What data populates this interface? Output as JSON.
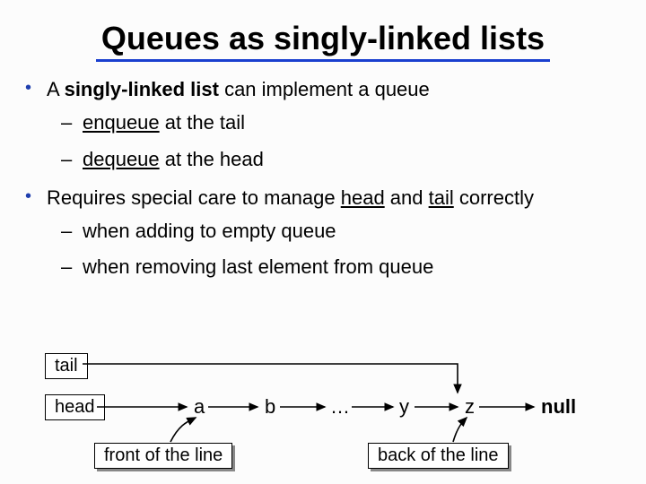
{
  "title": "Queues as singly-linked lists",
  "bullets": {
    "b1_pre": "A ",
    "b1_bold": "singly-linked list",
    "b1_post": " can implement a queue",
    "b1a_pre": "",
    "b1a_ul": "enqueue",
    "b1a_post": " at the tail",
    "b1b_pre": "",
    "b1b_ul": "dequeue",
    "b1b_post": " at the head",
    "b2_pre": "Requires special care to manage ",
    "b2_ul1": "head",
    "b2_mid": " and ",
    "b2_ul2": "tail",
    "b2_post": " correctly",
    "b2a": "when adding to empty queue",
    "b2b": "when removing last element from queue"
  },
  "diagram": {
    "tail": "tail",
    "head": "head",
    "a": "a",
    "b": "b",
    "dots": "…",
    "y": "y",
    "z": "z",
    "null": "null",
    "front": "front of the line",
    "back": "back of the line"
  }
}
